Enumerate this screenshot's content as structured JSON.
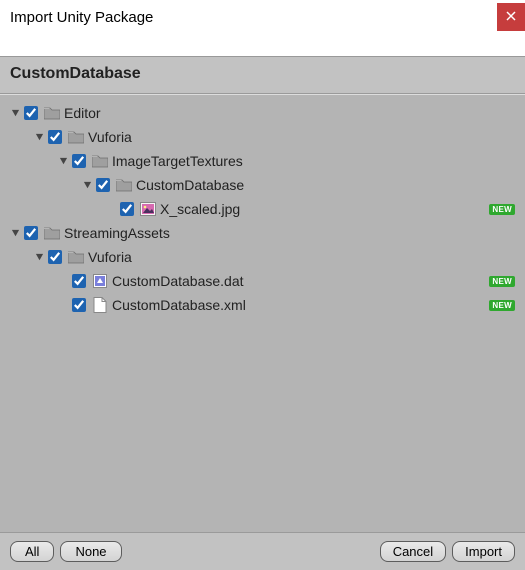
{
  "window": {
    "title": "Import Unity Package"
  },
  "package": {
    "name": "CustomDatabase"
  },
  "badges": {
    "new": "NEW"
  },
  "tree": [
    {
      "id": "editor",
      "depth": 0,
      "expandable": true,
      "checked": true,
      "icon": "folder",
      "label": "Editor"
    },
    {
      "id": "vuforia1",
      "depth": 1,
      "expandable": true,
      "checked": true,
      "icon": "folder",
      "label": "Vuforia"
    },
    {
      "id": "imagetargets",
      "depth": 2,
      "expandable": true,
      "checked": true,
      "icon": "folder",
      "label": "ImageTargetTextures"
    },
    {
      "id": "customdb",
      "depth": 3,
      "expandable": true,
      "checked": true,
      "icon": "folder",
      "label": "CustomDatabase"
    },
    {
      "id": "xscaled",
      "depth": 4,
      "expandable": false,
      "checked": true,
      "icon": "image",
      "label": "X_scaled.jpg",
      "badge": "new"
    },
    {
      "id": "streamingassets",
      "depth": 0,
      "expandable": true,
      "checked": true,
      "icon": "folder",
      "label": "StreamingAssets"
    },
    {
      "id": "vuforia2",
      "depth": 1,
      "expandable": true,
      "checked": true,
      "icon": "folder",
      "label": "Vuforia"
    },
    {
      "id": "customdbdat",
      "depth": 2,
      "expandable": false,
      "checked": true,
      "icon": "scene",
      "label": "CustomDatabase.dat",
      "badge": "new"
    },
    {
      "id": "customdbxml",
      "depth": 2,
      "expandable": false,
      "checked": true,
      "icon": "doc",
      "label": "CustomDatabase.xml",
      "badge": "new"
    }
  ],
  "footer": {
    "all": "All",
    "none": "None",
    "cancel": "Cancel",
    "import": "Import"
  }
}
